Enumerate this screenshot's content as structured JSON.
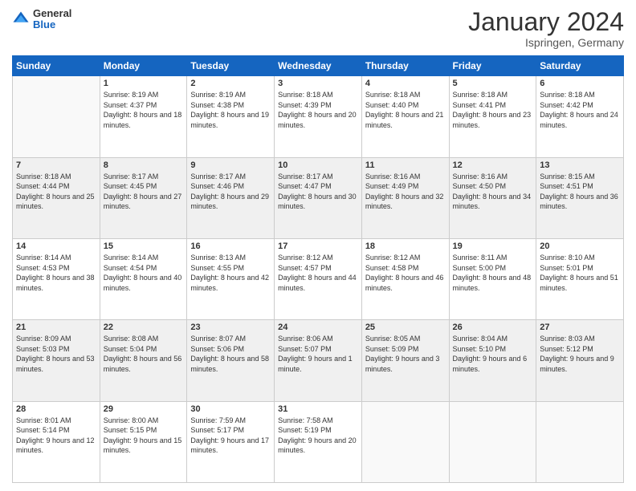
{
  "logo": {
    "general": "General",
    "blue": "Blue"
  },
  "title": "January 2024",
  "location": "Ispringen, Germany",
  "weekdays": [
    "Sunday",
    "Monday",
    "Tuesday",
    "Wednesday",
    "Thursday",
    "Friday",
    "Saturday"
  ],
  "weeks": [
    [
      {
        "day": "",
        "sunrise": "",
        "sunset": "",
        "daylight": ""
      },
      {
        "day": "1",
        "sunrise": "8:19 AM",
        "sunset": "4:37 PM",
        "daylight": "8 hours and 18 minutes."
      },
      {
        "day": "2",
        "sunrise": "8:19 AM",
        "sunset": "4:38 PM",
        "daylight": "8 hours and 19 minutes."
      },
      {
        "day": "3",
        "sunrise": "8:18 AM",
        "sunset": "4:39 PM",
        "daylight": "8 hours and 20 minutes."
      },
      {
        "day": "4",
        "sunrise": "8:18 AM",
        "sunset": "4:40 PM",
        "daylight": "8 hours and 21 minutes."
      },
      {
        "day": "5",
        "sunrise": "8:18 AM",
        "sunset": "4:41 PM",
        "daylight": "8 hours and 23 minutes."
      },
      {
        "day": "6",
        "sunrise": "8:18 AM",
        "sunset": "4:42 PM",
        "daylight": "8 hours and 24 minutes."
      }
    ],
    [
      {
        "day": "7",
        "sunrise": "8:18 AM",
        "sunset": "4:44 PM",
        "daylight": "8 hours and 25 minutes."
      },
      {
        "day": "8",
        "sunrise": "8:17 AM",
        "sunset": "4:45 PM",
        "daylight": "8 hours and 27 minutes."
      },
      {
        "day": "9",
        "sunrise": "8:17 AM",
        "sunset": "4:46 PM",
        "daylight": "8 hours and 29 minutes."
      },
      {
        "day": "10",
        "sunrise": "8:17 AM",
        "sunset": "4:47 PM",
        "daylight": "8 hours and 30 minutes."
      },
      {
        "day": "11",
        "sunrise": "8:16 AM",
        "sunset": "4:49 PM",
        "daylight": "8 hours and 32 minutes."
      },
      {
        "day": "12",
        "sunrise": "8:16 AM",
        "sunset": "4:50 PM",
        "daylight": "8 hours and 34 minutes."
      },
      {
        "day": "13",
        "sunrise": "8:15 AM",
        "sunset": "4:51 PM",
        "daylight": "8 hours and 36 minutes."
      }
    ],
    [
      {
        "day": "14",
        "sunrise": "8:14 AM",
        "sunset": "4:53 PM",
        "daylight": "8 hours and 38 minutes."
      },
      {
        "day": "15",
        "sunrise": "8:14 AM",
        "sunset": "4:54 PM",
        "daylight": "8 hours and 40 minutes."
      },
      {
        "day": "16",
        "sunrise": "8:13 AM",
        "sunset": "4:55 PM",
        "daylight": "8 hours and 42 minutes."
      },
      {
        "day": "17",
        "sunrise": "8:12 AM",
        "sunset": "4:57 PM",
        "daylight": "8 hours and 44 minutes."
      },
      {
        "day": "18",
        "sunrise": "8:12 AM",
        "sunset": "4:58 PM",
        "daylight": "8 hours and 46 minutes."
      },
      {
        "day": "19",
        "sunrise": "8:11 AM",
        "sunset": "5:00 PM",
        "daylight": "8 hours and 48 minutes."
      },
      {
        "day": "20",
        "sunrise": "8:10 AM",
        "sunset": "5:01 PM",
        "daylight": "8 hours and 51 minutes."
      }
    ],
    [
      {
        "day": "21",
        "sunrise": "8:09 AM",
        "sunset": "5:03 PM",
        "daylight": "8 hours and 53 minutes."
      },
      {
        "day": "22",
        "sunrise": "8:08 AM",
        "sunset": "5:04 PM",
        "daylight": "8 hours and 56 minutes."
      },
      {
        "day": "23",
        "sunrise": "8:07 AM",
        "sunset": "5:06 PM",
        "daylight": "8 hours and 58 minutes."
      },
      {
        "day": "24",
        "sunrise": "8:06 AM",
        "sunset": "5:07 PM",
        "daylight": "9 hours and 1 minute."
      },
      {
        "day": "25",
        "sunrise": "8:05 AM",
        "sunset": "5:09 PM",
        "daylight": "9 hours and 3 minutes."
      },
      {
        "day": "26",
        "sunrise": "8:04 AM",
        "sunset": "5:10 PM",
        "daylight": "9 hours and 6 minutes."
      },
      {
        "day": "27",
        "sunrise": "8:03 AM",
        "sunset": "5:12 PM",
        "daylight": "9 hours and 9 minutes."
      }
    ],
    [
      {
        "day": "28",
        "sunrise": "8:01 AM",
        "sunset": "5:14 PM",
        "daylight": "9 hours and 12 minutes."
      },
      {
        "day": "29",
        "sunrise": "8:00 AM",
        "sunset": "5:15 PM",
        "daylight": "9 hours and 15 minutes."
      },
      {
        "day": "30",
        "sunrise": "7:59 AM",
        "sunset": "5:17 PM",
        "daylight": "9 hours and 17 minutes."
      },
      {
        "day": "31",
        "sunrise": "7:58 AM",
        "sunset": "5:19 PM",
        "daylight": "9 hours and 20 minutes."
      },
      {
        "day": "",
        "sunrise": "",
        "sunset": "",
        "daylight": ""
      },
      {
        "day": "",
        "sunrise": "",
        "sunset": "",
        "daylight": ""
      },
      {
        "day": "",
        "sunrise": "",
        "sunset": "",
        "daylight": ""
      }
    ]
  ]
}
